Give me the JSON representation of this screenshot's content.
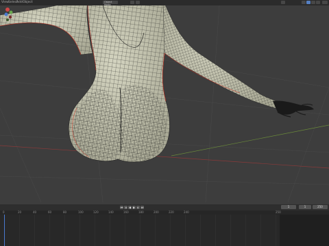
{
  "header": {
    "menu": [
      "View",
      "Select",
      "Add",
      "Object"
    ],
    "mode_label": "Object Mode",
    "shading_label": "Solid"
  },
  "timeline": {
    "current_frame": "1",
    "start_frame": "1",
    "end_frame": "250",
    "ruler_ticks": [
      "0",
      "20",
      "40",
      "60",
      "80",
      "100",
      "120",
      "140",
      "160",
      "180",
      "200",
      "220",
      "240",
      "250"
    ]
  },
  "colors": {
    "mesh_fill": "#c8c8b4",
    "wire": "#1c1c1c",
    "seam": "#d03020",
    "grid_x_axis": "#8a3a3a",
    "grid_y_axis": "#6a8a3a"
  }
}
